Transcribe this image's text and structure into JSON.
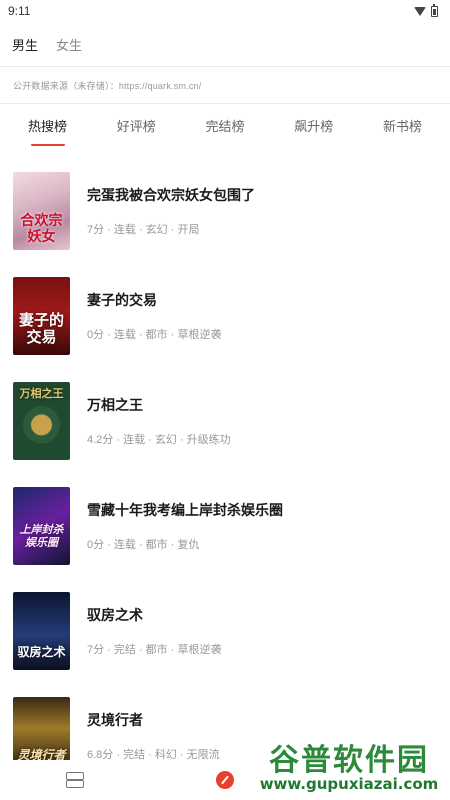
{
  "status_bar": {
    "time": "9:11",
    "wifi_icon": "wifi-icon",
    "battery_icon": "battery-icon"
  },
  "gender_tabs": [
    {
      "label": "男生",
      "active": true
    },
    {
      "label": "女生",
      "active": false
    }
  ],
  "source_note": "公开数据来源（未存储）：https://quark.sm.cn/",
  "rank_tabs": [
    {
      "label": "热搜榜",
      "active": true
    },
    {
      "label": "好评榜",
      "active": false
    },
    {
      "label": "完结榜",
      "active": false
    },
    {
      "label": "飙升榜",
      "active": false
    },
    {
      "label": "新书榜",
      "active": false
    }
  ],
  "books": [
    {
      "title": "完蛋我被合欢宗妖女包围了",
      "meta": "7分 · 连载 · 玄幻 · 开局",
      "cover_text": "合欢宗妖女"
    },
    {
      "title": "妻子的交易",
      "meta": "0分 · 连载 · 都市 · 草根逆袭",
      "cover_text": "妻子的交易"
    },
    {
      "title": "万相之王",
      "meta": "4.2分 · 连载 · 玄幻 · 升级练功",
      "cover_text": "万相之王"
    },
    {
      "title": "雪藏十年我考编上岸封杀娱乐圈",
      "meta": "0分 · 连载 · 都市 · 复仇",
      "cover_text": "上岸封杀娱乐圈"
    },
    {
      "title": "驭房之术",
      "meta": "7分 · 完结 · 都市 · 草根逆袭",
      "cover_text": "驭房之术"
    },
    {
      "title": "灵境行者",
      "meta": "6.8分 · 完结 · 科幻 · 无限流",
      "cover_text": "灵境行者"
    }
  ],
  "bottom_nav": [
    {
      "icon": "bookshelf-icon"
    },
    {
      "icon": "discover-icon",
      "active": true
    }
  ],
  "watermark": {
    "text": "谷普软件园",
    "url": "www.gupuxiazai.com"
  },
  "colors": {
    "accent": "#e5412d",
    "watermark": "#2c8a3a"
  }
}
